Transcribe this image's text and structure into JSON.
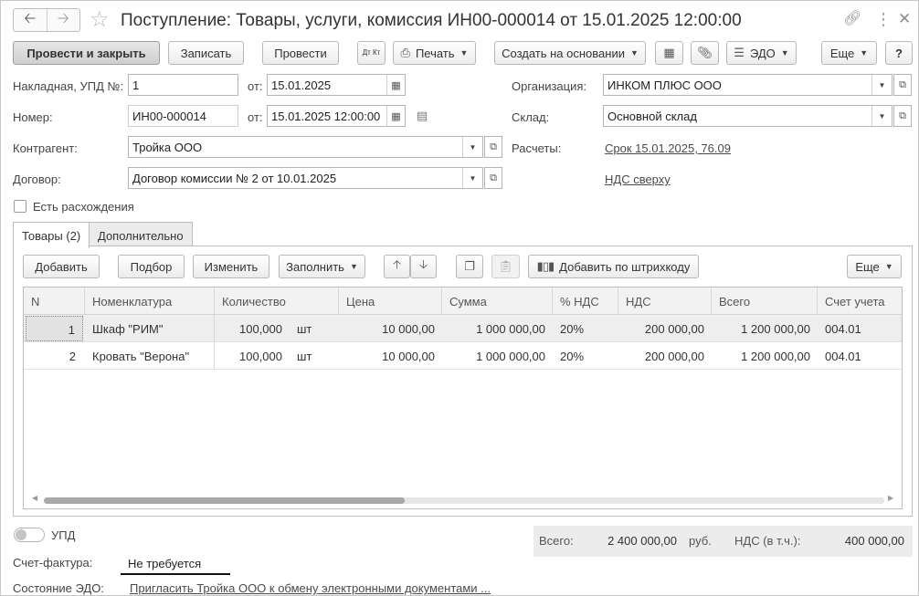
{
  "window": {
    "title": "Поступление: Товары, услуги, комиссия ИН00-000014 от 15.01.2025 12:00:00",
    "icons": [
      "back-arrow-icon",
      "forward-arrow-icon",
      "favorite-star-icon",
      "link-icon",
      "more-vertical-icon",
      "close-icon"
    ]
  },
  "toolbar": {
    "post_close": "Провести и закрыть",
    "save": "Записать",
    "post": "Провести",
    "dt_kt": "Дт Кт",
    "print": "Печать",
    "create_based": "Создать на основании",
    "edo": "ЭДО",
    "more": "Еще",
    "help": "?"
  },
  "form": {
    "invoice_label": "Накладная, УПД №:",
    "invoice_no": "1",
    "from_label": "от:",
    "invoice_date": "15.01.2025",
    "number_label": "Номер:",
    "number": "ИН00-000014",
    "number_from_label": "от:",
    "number_date": "15.01.2025 12:00:00",
    "counterparty_label": "Контрагент:",
    "counterparty": "Тройка ООО",
    "contract_label": "Договор:",
    "contract": "Договор комиссии № 2 от 10.01.2025",
    "organization_label": "Организация:",
    "organization": "ИНКОМ ПЛЮС ООО",
    "warehouse_label": "Склад:",
    "warehouse": "Основной склад",
    "settlements_label": "Расчеты:",
    "settlements_link": "Срок 15.01.2025, 76.09",
    "vat_link": "НДС сверху",
    "discrepancy_label": "Есть расхождения",
    "discrepancy_checked": false
  },
  "tabs": [
    {
      "label": "Товары (2)",
      "active": true
    },
    {
      "label": "Дополнительно",
      "active": false
    }
  ],
  "table_toolbar": {
    "add": "Добавить",
    "pick": "Подбор",
    "edit": "Изменить",
    "fill": "Заполнить",
    "barcode": "Добавить по штрихкоду",
    "more": "Еще"
  },
  "table": {
    "columns": [
      "N",
      "Номенклатура",
      "Количество",
      "Цена",
      "Сумма",
      "% НДС",
      "НДС",
      "Всего",
      "Счет учета"
    ],
    "rows": [
      {
        "n": "1",
        "name": "Шкаф \"РИМ\"",
        "qty": "100,000",
        "unit": "шт",
        "price": "10 000,00",
        "sum": "1 000 000,00",
        "vat_rate": "20%",
        "vat": "200 000,00",
        "total": "1 200 000,00",
        "account": "004.01"
      },
      {
        "n": "2",
        "name": "Кровать \"Верона\"",
        "qty": "100,000",
        "unit": "шт",
        "price": "10 000,00",
        "sum": "1 000 000,00",
        "vat_rate": "20%",
        "vat": "200 000,00",
        "total": "1 200 000,00",
        "account": "004.01"
      }
    ]
  },
  "footer": {
    "upd_label": "УПД",
    "upd_on": false,
    "invoice_label": "Счет-фактура:",
    "invoice_value": "Не требуется",
    "edo_label": "Состояние ЭДО:",
    "edo_link": "Пригласить Тройка ООО к обмену электронными документами ...",
    "total_label": "Всего:",
    "total_value": "2 400 000,00",
    "currency": "руб.",
    "vat_label": "НДС (в т.ч.):",
    "vat_value": "400 000,00"
  }
}
